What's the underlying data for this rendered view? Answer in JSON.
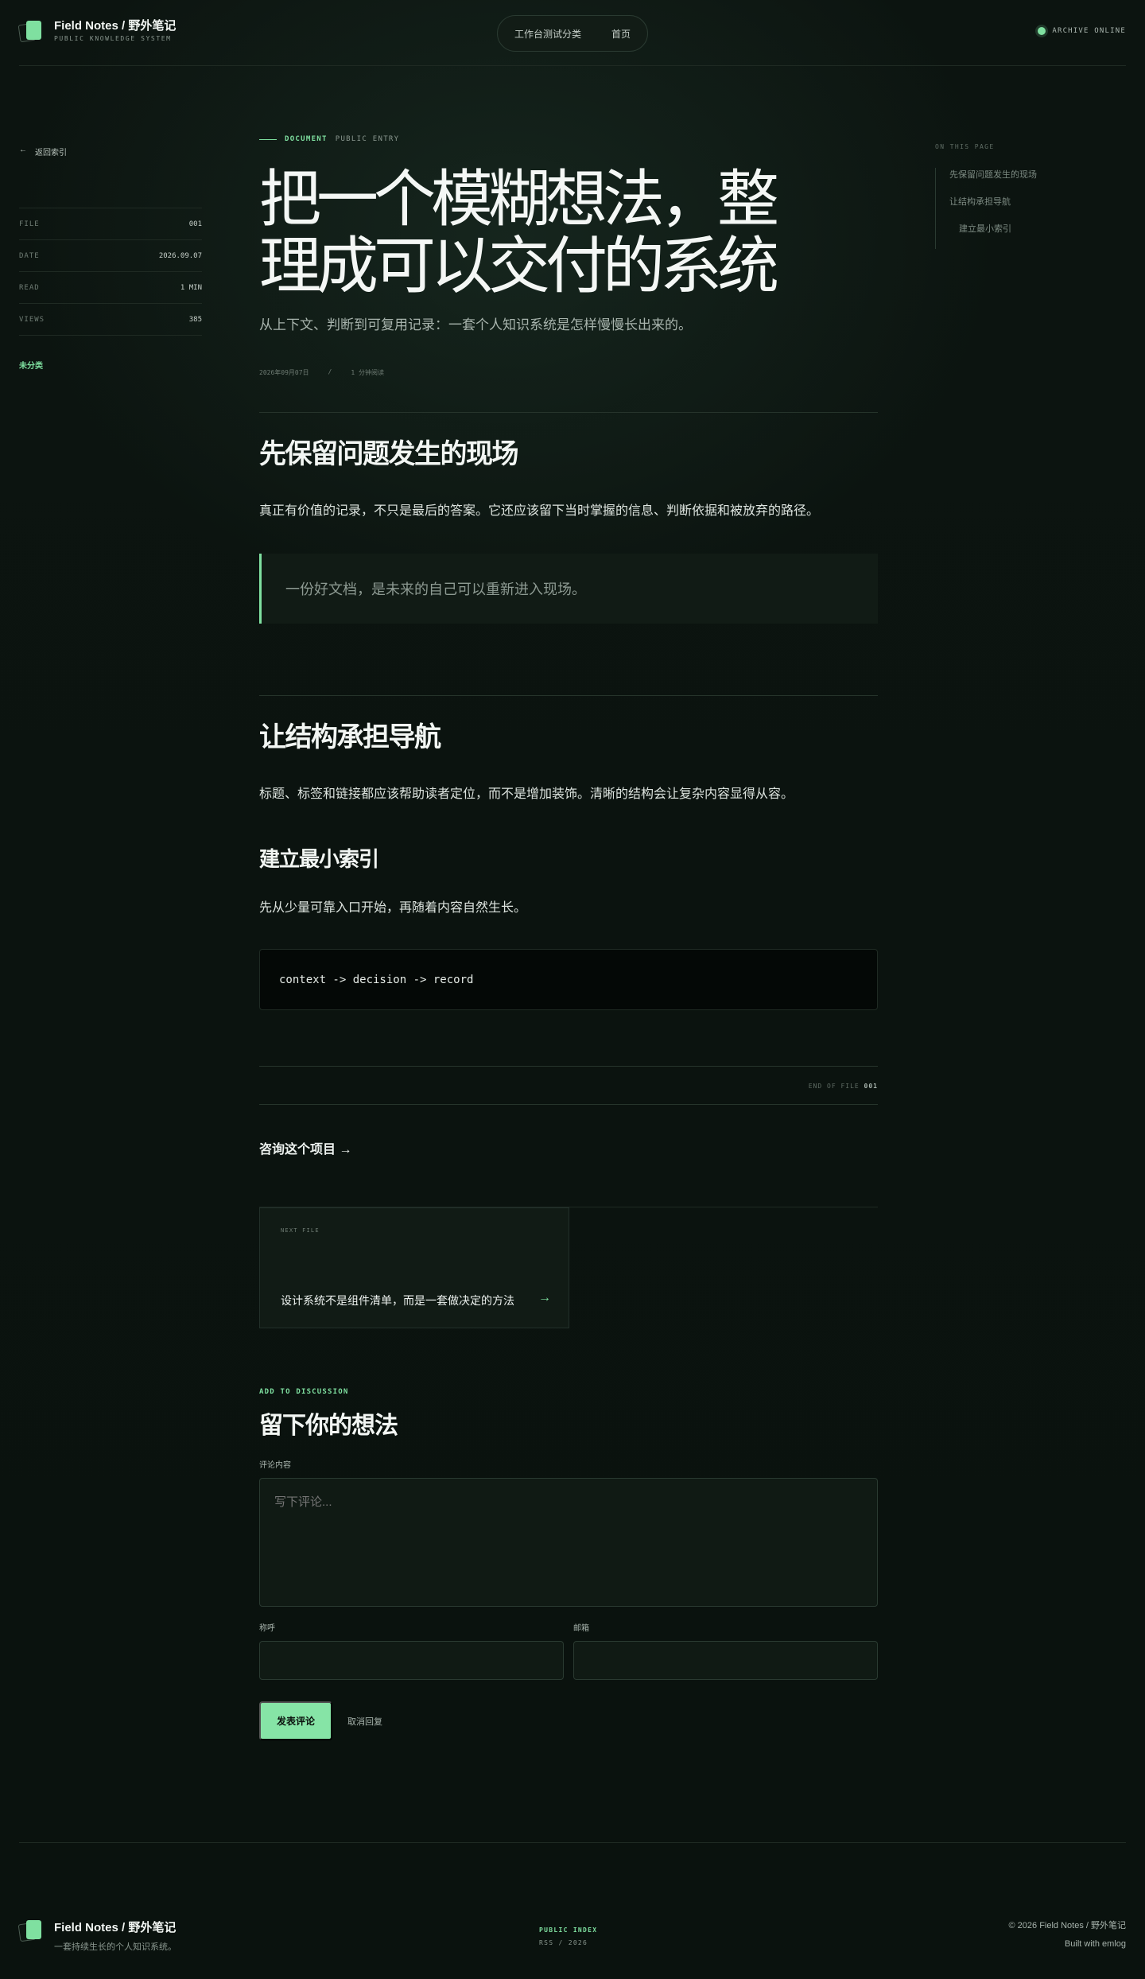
{
  "header": {
    "brand_title": "Field Notes / 野外笔记",
    "brand_subtitle": "PUBLIC KNOWLEDGE SYSTEM",
    "nav": [
      "工作台测试分类",
      "首页"
    ],
    "status": "ARCHIVE ONLINE"
  },
  "sidebar": {
    "back_label": "返回索引",
    "meta": [
      {
        "key": "FILE",
        "value": "001"
      },
      {
        "key": "DATE",
        "value": "2026.09.07"
      },
      {
        "key": "READ",
        "value": "1 MIN"
      },
      {
        "key": "VIEWS",
        "value": "385"
      }
    ],
    "category": "未分类"
  },
  "toc": {
    "label": "ON THIS PAGE",
    "items": [
      "先保留问题发生的现场",
      "让结构承担导航",
      "建立最小索引"
    ]
  },
  "article": {
    "kicker_primary": "DOCUMENT",
    "kicker_secondary": "PUBLIC ENTRY",
    "title": "把一个模糊想法，整理成可以交付的系统",
    "lead": "从上下文、判断到可复用记录：一套个人知识系统是怎样慢慢长出来的。",
    "date": "2026年09月07日",
    "separator": "/",
    "read_time": "1 分钟阅读",
    "section1_heading": "先保留问题发生的现场",
    "section1_body": "真正有价值的记录，不只是最后的答案。它还应该留下当时掌握的信息、判断依据和被放弃的路径。",
    "quote": "一份好文档，是未来的自己可以重新进入现场。",
    "section2_heading": "让结构承担导航",
    "section2_body": "标题、标签和链接都应该帮助读者定位，而不是增加装饰。清晰的结构会让复杂内容显得从容。",
    "section3_heading": "建立最小索引",
    "section3_body": "先从少量可靠入口开始，再随着内容自然生长。",
    "code": "context -> decision -> record",
    "eof_label": "END OF FILE",
    "eof_num": "001",
    "consult_link": "咨询这个项目 →"
  },
  "next": {
    "label": "NEXT FILE",
    "title": "设计系统不是组件清单，而是一套做决定的方法",
    "arrow": "→"
  },
  "comments": {
    "kicker": "ADD TO DISCUSSION",
    "title": "留下你的想法",
    "content_label": "评论内容",
    "content_placeholder": "写下评论...",
    "name_label": "称呼",
    "email_label": "邮箱",
    "submit_label": "发表评论",
    "cancel_label": "取消回复"
  },
  "footer": {
    "brand_title": "Field Notes / 野外笔记",
    "brand_subtitle": "一套持续生长的个人知识系统。",
    "mid_title": "PUBLIC INDEX",
    "mid_sub": "RSS / 2026",
    "copyright": "© 2026 Field Notes / 野外笔记",
    "built_with": "Built with emlog"
  },
  "colors": {
    "background": "#0b120e",
    "accent": "#7fe0a0",
    "text": "#e6ece7"
  }
}
